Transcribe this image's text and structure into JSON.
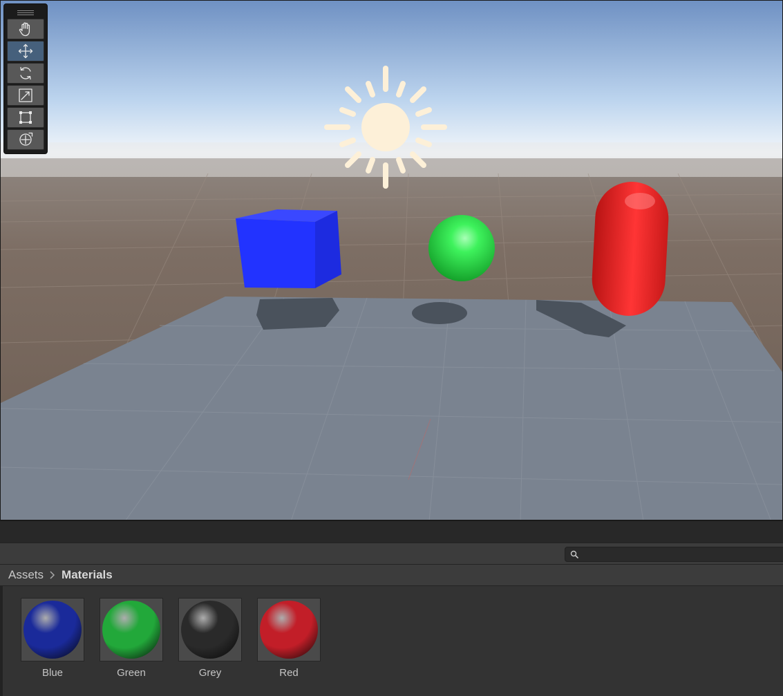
{
  "scene": {
    "tools": [
      {
        "name": "hand-tool",
        "active": false
      },
      {
        "name": "move-tool",
        "active": true
      },
      {
        "name": "rotate-tool",
        "active": false
      },
      {
        "name": "scale-tool",
        "active": false
      },
      {
        "name": "rect-tool",
        "active": false
      },
      {
        "name": "transform-tool",
        "active": false
      }
    ],
    "objects": {
      "cube_color": "#2233ff",
      "sphere_color": "#22dd44",
      "capsule_color": "#ee2222",
      "light_icon_color": "#fdf0d8"
    }
  },
  "project": {
    "search": {
      "value": "",
      "placeholder": ""
    },
    "breadcrumb": {
      "root": "Assets",
      "current": "Materials"
    },
    "materials": [
      {
        "label": "Blue",
        "color": "#1a2a9a"
      },
      {
        "label": "Green",
        "color": "#22a83a"
      },
      {
        "label": "Grey",
        "color": "#2a2a2a"
      },
      {
        "label": "Red",
        "color": "#c21e28"
      }
    ]
  }
}
